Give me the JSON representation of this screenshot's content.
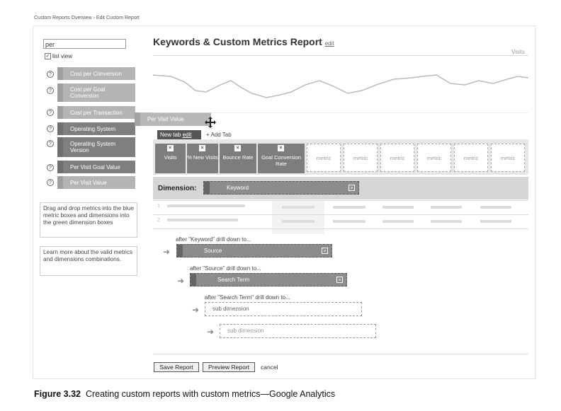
{
  "breadcrumb": "Custom Reports Overview › Edit Custom Report",
  "sidebar": {
    "search_value": "per",
    "list_view_label": "list view",
    "list_view_checked": "✓",
    "help_glyph": "?",
    "items": [
      {
        "label": "Cost per Conversion",
        "style": "light"
      },
      {
        "label": "Cost per Goal Conversion",
        "style": "light"
      },
      {
        "label": "Cost per Transaction",
        "style": "light"
      },
      {
        "label": "Operating System",
        "style": "dark"
      },
      {
        "label": "Operating System Version",
        "style": "dark"
      },
      {
        "label": "Per Visit Goal Value",
        "style": "dark"
      },
      {
        "label": "Per Visit Value",
        "style": "light"
      }
    ],
    "dragging_label": "Per Visit Value",
    "info_drag": "Drag and drop metrics into the blue metric boxes and dimensions into the green dimension boxes",
    "info_learn": "Learn more about the valid metrics and dimensions combinations."
  },
  "report": {
    "title": "Keywords & Custom Metrics Report",
    "edit_label": "edit",
    "graph_metric": "Visits"
  },
  "tabs": {
    "active": "New tab",
    "edit_label": "edit",
    "add_label": "+ Add Tab"
  },
  "metrics": {
    "close_glyph": "×",
    "filled": [
      "Visits",
      "% New Visits",
      "Bounce Rate",
      "Goal Conversion Rate"
    ],
    "empty": [
      "metric",
      "metric",
      "metric",
      "metric",
      "metric",
      "metric"
    ]
  },
  "dimension": {
    "label": "Dimension:",
    "value": "Keyword"
  },
  "table_rows": [
    "1",
    "2"
  ],
  "drilldowns": [
    {
      "caption": "after \"Keyword\" drill down to...",
      "value": "Source"
    },
    {
      "caption": "after \"Source\" drill down to...",
      "value": "Search Term"
    },
    {
      "caption": "after \"Search Term\" drill down to...",
      "value": "sub dimension"
    },
    {
      "caption": "",
      "value": "sub dimension"
    }
  ],
  "buttons": {
    "save": "Save Report",
    "preview": "Preview Report",
    "cancel": "cancel"
  },
  "caption": {
    "number": "Figure 3.32",
    "text": "Creating custom reports with custom metrics—Google Analytics"
  }
}
